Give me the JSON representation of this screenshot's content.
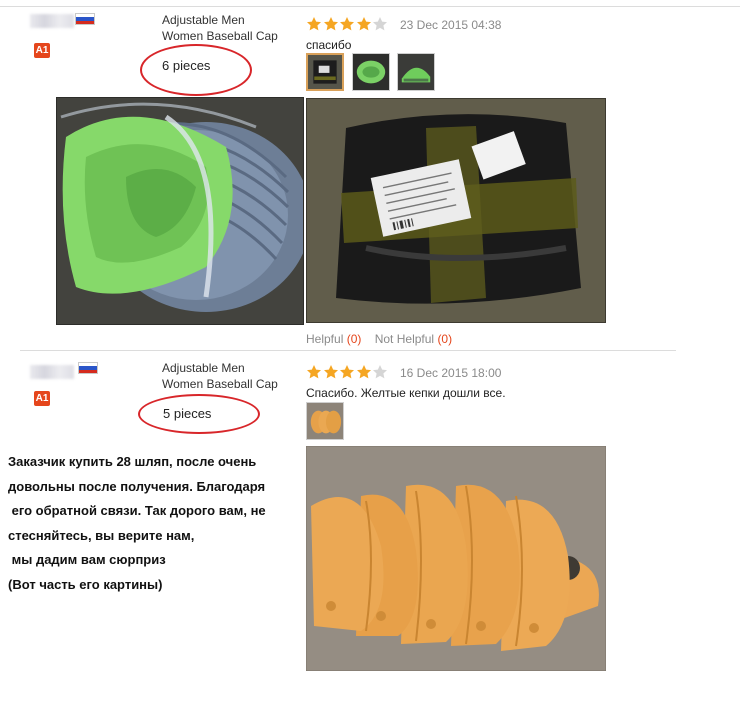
{
  "reviews": [
    {
      "flag": "russia-flag",
      "badge": "A1",
      "product": [
        "Adjustable Men",
        "Women Baseball Cap"
      ],
      "quantity_note": "6 pieces",
      "rating": 4,
      "date": "23 Dec 2015 04:38",
      "comment": "спасибо",
      "thumbnails": [
        "photo-thumbnail-black-package",
        "photo-thumbnail-green-caps",
        "photo-thumbnail-green-caps-side"
      ],
      "helpful_label": "Helpful",
      "helpful_count": "(0)",
      "not_helpful_label": "Not Helpful",
      "not_helpful_count": "(0)"
    },
    {
      "flag": "russia-flag",
      "badge": "A1",
      "product": [
        "Adjustable Men",
        "Women Baseball Cap"
      ],
      "quantity_note": "5 pieces",
      "rating": 4,
      "date": "16 Dec 2015 18:00",
      "comment": "Спасибо. Желтые кепки дошли все.",
      "thumbnails": [
        "photo-thumbnail-orange-caps"
      ]
    }
  ],
  "promo_text": "Заказчик купить 28 шляп, после очень\nдовольны после получения. Благодаря\n его обратной связи. Так дорого вам, не\nстесняйтесь, вы верите нам,\n мы дадим вам сюрприз\n(Вот часть его картины)",
  "colors": {
    "star": "#f5a623",
    "accent": "#e5461c",
    "circle": "#d8262a"
  }
}
